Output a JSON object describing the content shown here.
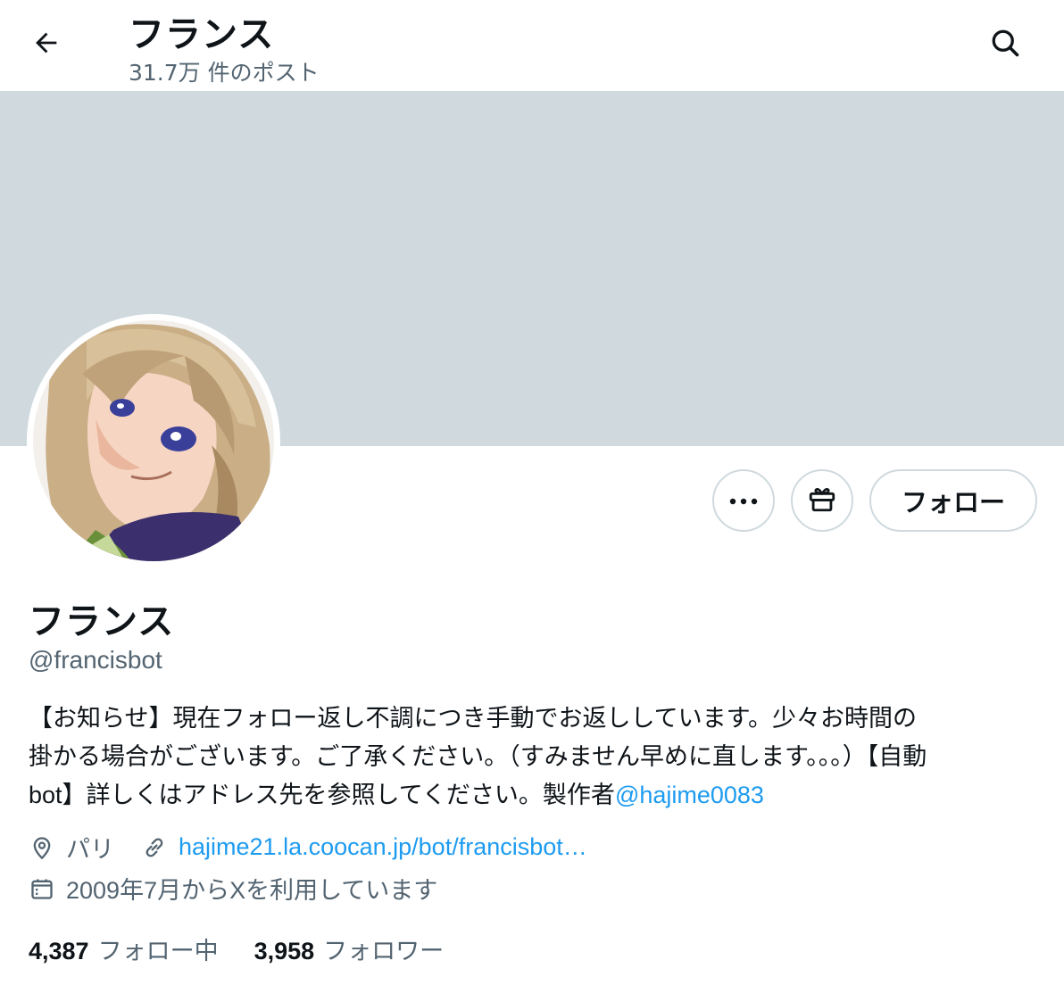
{
  "header": {
    "title": "フランス",
    "post_count": "31.7万 件のポスト",
    "back_icon": "arrow-left-icon",
    "search_icon": "search-icon"
  },
  "actions": {
    "more_label": "…",
    "gift_icon": "gift-icon",
    "follow_label": "フォロー"
  },
  "profile": {
    "name": "フランス",
    "handle": "@francisbot",
    "bio_line1": "【お知らせ】現在フォロー返し不調につき手動でお返ししています。少々お時間の",
    "bio_line2": "掛かる場合がございます。ご了承ください。（すみません早めに直します。。。）【自動",
    "bio_line3_prefix": "bot",
    "bio_line3_text": "】詳しくはアドレス先を参照してください。製作者",
    "bio_mention": "@hajime0083",
    "location": "パリ",
    "website": "hajime21.la.coocan.jp/bot/francisbot…",
    "joined": "2009年7月からXを利用しています",
    "following_count": "4,387",
    "following_label": "フォロー中",
    "followers_count": "3,958",
    "followers_label": "フォロワー"
  },
  "colors": {
    "banner": "#cfd9de",
    "link": "#1d9bf0",
    "secondary_text": "#536471",
    "primary_text": "#0f1419"
  }
}
